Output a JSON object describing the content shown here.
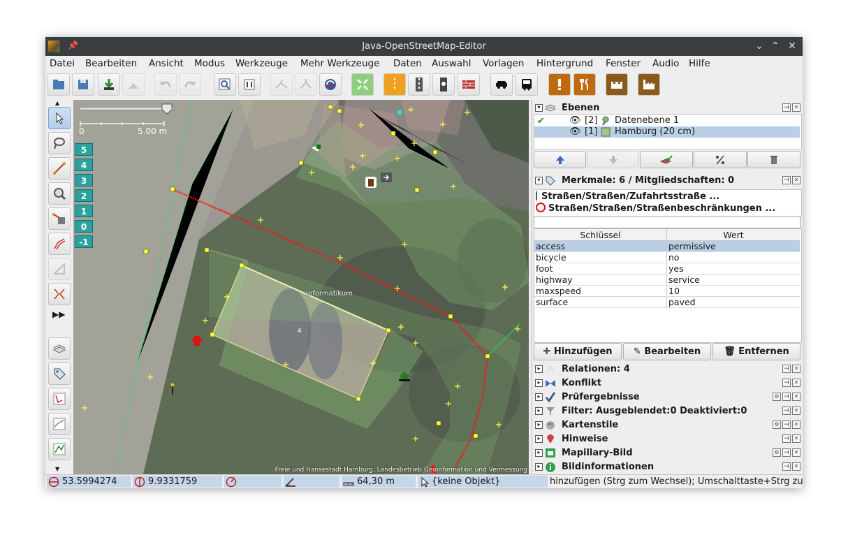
{
  "window": {
    "title": "Java-OpenStreetMap-Editor"
  },
  "menu": [
    "Datei",
    "Bearbeiten",
    "Ansicht",
    "Modus",
    "Werkzeuge",
    "Mehr Werkzeuge",
    "Daten",
    "Auswahl",
    "Vorlagen",
    "Hintergrund",
    "Fenster",
    "Audio",
    "Hilfe"
  ],
  "map": {
    "layer_buttons": [
      "5",
      "4",
      "3",
      "2",
      "1",
      "0",
      "-1"
    ],
    "scale_left": "0",
    "scale_right": "5.00 m",
    "building_label": "Informatikum",
    "house_number": "4",
    "attribution": "Freie und Hansestadt Hamburg, Landesbetrieb Geoinformation und Vermessung"
  },
  "layers_panel": {
    "title": "Ebenen",
    "layers": [
      {
        "index": "[2]",
        "name": "Datenebene 1",
        "selected": false
      },
      {
        "index": "[1]",
        "name": "Hamburg (20 cm)",
        "selected": true
      }
    ]
  },
  "tags_panel": {
    "title": "Merkmale: 6 / Mitgliedschaften: 0",
    "presets": [
      "Straßen/Straßen/Zufahrtsstraße ...",
      "Straßen/Straßen/Straßenbeschränkungen ..."
    ],
    "column_key": "Schlüssel",
    "column_value": "Wert",
    "rows": [
      {
        "key": "access",
        "value": "permissive"
      },
      {
        "key": "bicycle",
        "value": "no"
      },
      {
        "key": "foot",
        "value": "yes"
      },
      {
        "key": "highway",
        "value": "service"
      },
      {
        "key": "maxspeed",
        "value": "10"
      },
      {
        "key": "surface",
        "value": "paved"
      }
    ],
    "btn_add": "Hinzufügen",
    "btn_edit": "Bearbeiten",
    "btn_remove": "Entfernen"
  },
  "collapsed_panels": [
    "Relationen: 4",
    "Konflikt",
    "Prüfergebnisse",
    "Filter: Ausgeblendet:0 Deaktiviert:0",
    "Kartenstile",
    "Hinweise",
    "Mapillary-Bild",
    "Bildinformationen"
  ],
  "status": {
    "lat": "53.5994274",
    "lon": "9.9331759",
    "distance": "64,30 m",
    "object": "{keine Objekt}",
    "help": "hinzufügen (Strg zum Wechsel); Umschalttaste+Strg zum Drehen"
  },
  "colors": {
    "accent_layer_button": "#2aa3a0",
    "selected_way": "#ff0000",
    "selection_highlight": "#b8cfe5",
    "status_field": "#c5d6ea"
  }
}
